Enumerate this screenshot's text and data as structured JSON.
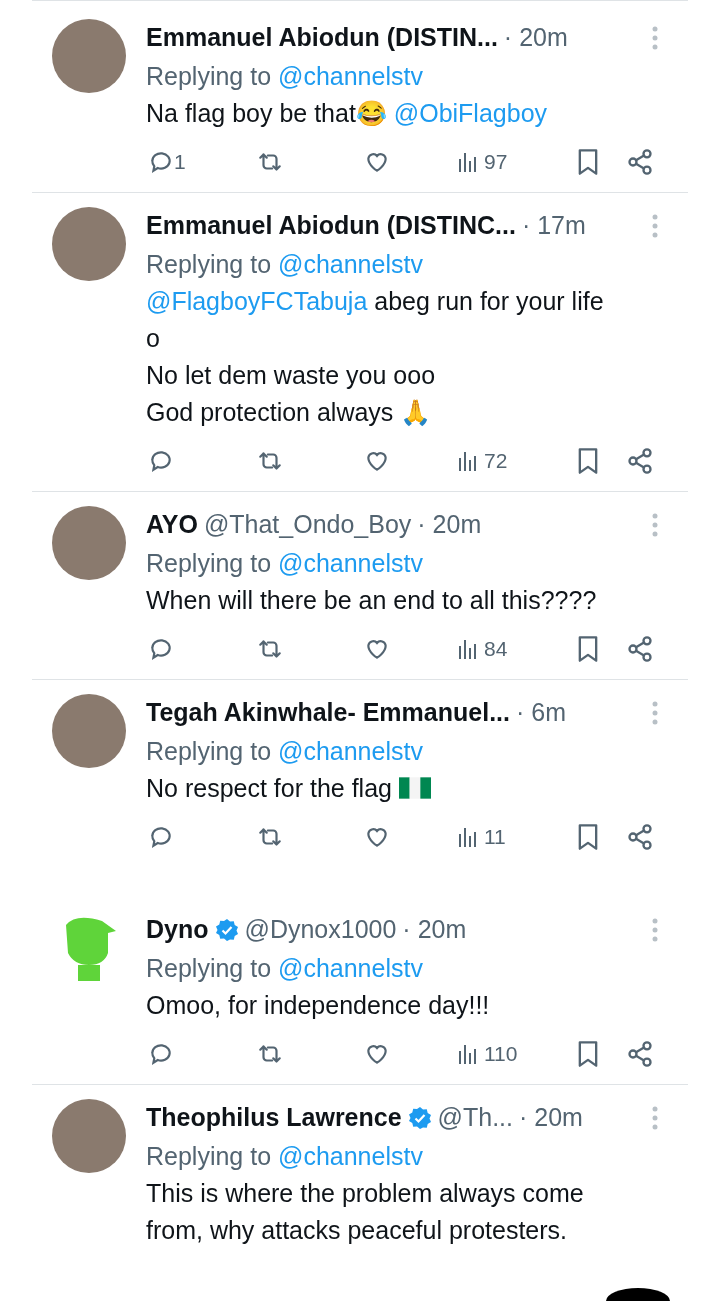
{
  "tweets": [
    {
      "avatar": {
        "kind": "photo"
      },
      "name": "Emmanuel Abiodun (DISTIN...",
      "verified": false,
      "time": "· 20m",
      "replying_label": "Replying to",
      "replying_to": "@channelstv",
      "body": [
        [
          {
            "kind": "text",
            "text": "Na flag boy be that😂 "
          },
          {
            "kind": "mention",
            "text": "@ObiFlagboy"
          }
        ]
      ],
      "replies": "1",
      "views": "97",
      "divider_below": true
    },
    {
      "avatar": {
        "kind": "photo"
      },
      "name": "Emmanuel Abiodun (DISTINC...",
      "verified": false,
      "time": "· 17m",
      "replying_label": "Replying to",
      "replying_to": "@channelstv",
      "body": [
        [
          {
            "kind": "mention",
            "text": "@FlagboyFCTabuja"
          },
          {
            "kind": "text",
            "text": " abeg run for your life"
          }
        ],
        [
          {
            "kind": "text",
            "text": "o"
          }
        ],
        [
          {
            "kind": "text",
            "text": "No let dem waste you ooo"
          }
        ],
        [
          {
            "kind": "text",
            "text": "God protection always 🙏"
          }
        ]
      ],
      "views": "72",
      "divider_below": true
    },
    {
      "avatar": {
        "kind": "photo"
      },
      "name": "AYO",
      "handle": "@That_Ondo_Boy",
      "verified": false,
      "time": "· 20m",
      "replying_label": "Replying to",
      "replying_to": "@channelstv",
      "body": [
        [
          {
            "kind": "text",
            "text": "When will there be an end to all this????"
          }
        ]
      ],
      "views": "84",
      "divider_below": true
    },
    {
      "avatar": {
        "kind": "photo"
      },
      "name": "Tegah Akinwhale- Emmanuel...",
      "verified": false,
      "time": "· 6m",
      "replying_label": "Replying to",
      "replying_to": "@channelstv",
      "body": [
        [
          {
            "kind": "text",
            "text": "No respect for the flag "
          },
          {
            "kind": "flag"
          }
        ]
      ],
      "views": "11",
      "divider_below": false
    },
    {
      "avatar": {
        "kind": "cartoon"
      },
      "name": "Dyno",
      "handle": "@Dynox1000",
      "verified": true,
      "time": "· 20m",
      "replying_label": "Replying to",
      "replying_to": "@channelstv",
      "body": [
        [
          {
            "kind": "text",
            "text": "Omoo, for independence day!!!"
          }
        ]
      ],
      "views": "110",
      "divider_below": true
    },
    {
      "avatar": {
        "kind": "photo"
      },
      "name": "Theophilus Lawrence",
      "handle": "@Th...",
      "verified": true,
      "time": "· 20m",
      "replying_label": "Replying to",
      "replying_to": "@channelstv",
      "body": [
        [
          {
            "kind": "text",
            "text": "This is where the problem always come"
          }
        ],
        [
          {
            "kind": "text",
            "text": "from, why attacks peaceful protesters."
          }
        ]
      ],
      "divider_below": false
    }
  ]
}
